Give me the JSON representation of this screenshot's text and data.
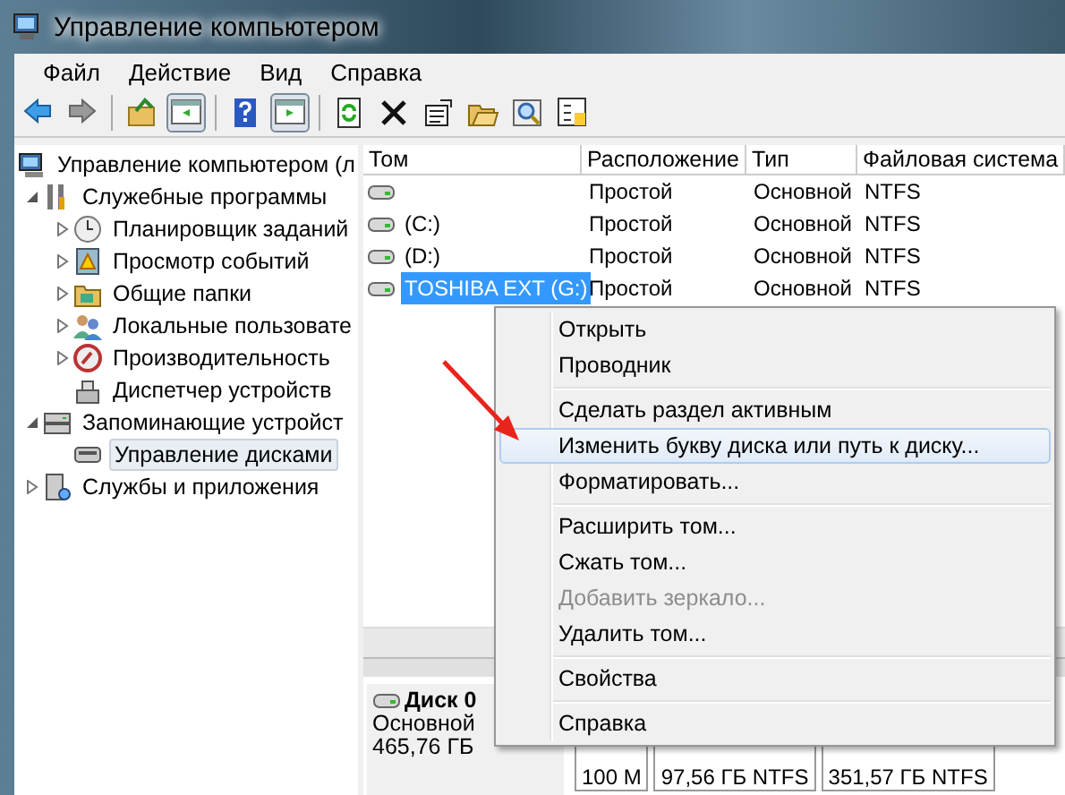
{
  "window": {
    "title": "Управление компьютером"
  },
  "menu_bar": [
    "Файл",
    "Действие",
    "Вид",
    "Справка"
  ],
  "toolbar": [
    {
      "kind": "back",
      "on": false
    },
    {
      "kind": "forward",
      "on": false
    },
    {
      "kind": "separator"
    },
    {
      "kind": "up",
      "on": false
    },
    {
      "kind": "tree",
      "on": true
    },
    {
      "kind": "separator"
    },
    {
      "kind": "help",
      "on": false
    },
    {
      "kind": "actions",
      "on": true
    },
    {
      "kind": "separator"
    },
    {
      "kind": "refresh",
      "on": false
    },
    {
      "kind": "delete",
      "on": false
    },
    {
      "kind": "properties",
      "on": false
    },
    {
      "kind": "open",
      "on": false
    },
    {
      "kind": "search",
      "on": false
    },
    {
      "kind": "more",
      "on": false
    }
  ],
  "tree": [
    {
      "label": "Управление компьютером (л",
      "selected": false,
      "children": [
        {
          "label": "Служебные программы",
          "expanded": true,
          "selected": false,
          "children": [
            {
              "label": "Планировщик заданий",
              "expanded": false,
              "selected": false
            },
            {
              "label": "Просмотр событий",
              "expanded": false,
              "selected": false
            },
            {
              "label": "Общие папки",
              "expanded": false,
              "selected": false
            },
            {
              "label": "Локальные пользовате",
              "expanded": false,
              "selected": false
            },
            {
              "label": "Производительность",
              "expanded": false,
              "selected": false
            },
            {
              "label": "Диспетчер устройств",
              "selected": false
            }
          ]
        },
        {
          "label": "Запоминающие устройст",
          "expanded": true,
          "selected": false,
          "children": [
            {
              "label": "Управление дисками",
              "selected": true
            }
          ]
        },
        {
          "label": "Службы и приложения",
          "expanded": false,
          "selected": false
        }
      ]
    }
  ],
  "volumes": {
    "columns": [
      "Том",
      "Расположение",
      "Тип",
      "Файловая система"
    ],
    "rows": [
      {
        "layout": "Простой",
        "type": "Основной",
        "fs": "NTFS",
        "selected": false
      },
      {
        "name": "(C:)",
        "layout": "Простой",
        "type": "Основной",
        "fs": "NTFS",
        "selected": false
      },
      {
        "name": "(D:)",
        "layout": "Простой",
        "type": "Основной",
        "fs": "NTFS",
        "selected": false
      },
      {
        "name": "TOSHIBA EXT (G:)",
        "layout": "Простой",
        "type": "Основной",
        "fs": "NTFS",
        "selected": true
      }
    ]
  },
  "disk": {
    "name": "Диск 0",
    "type": "Основной",
    "size": "465,76 ГБ",
    "partitions": [
      "100 М",
      "97,56 ГБ NTFS",
      "351,57 ГБ NTFS"
    ]
  },
  "context_menu": [
    {
      "kind": "item",
      "label": "Открыть",
      "disabled": false,
      "selected": false
    },
    {
      "kind": "item",
      "label": "Проводник",
      "disabled": false,
      "selected": false
    },
    {
      "kind": "separator"
    },
    {
      "kind": "item",
      "label": "Сделать раздел активным",
      "disabled": false,
      "selected": false
    },
    {
      "kind": "item",
      "label": "Изменить букву диска или путь к диску...",
      "disabled": false,
      "selected": true
    },
    {
      "kind": "item",
      "label": "Форматировать...",
      "disabled": false,
      "selected": false
    },
    {
      "kind": "separator"
    },
    {
      "kind": "item",
      "label": "Расширить том...",
      "disabled": false,
      "selected": false
    },
    {
      "kind": "item",
      "label": "Сжать том...",
      "disabled": false,
      "selected": false
    },
    {
      "kind": "item",
      "label": "Добавить зеркало...",
      "disabled": true,
      "selected": false
    },
    {
      "kind": "item",
      "label": "Удалить том...",
      "disabled": false,
      "selected": false
    },
    {
      "kind": "separator"
    },
    {
      "kind": "item",
      "label": "Свойства",
      "disabled": false,
      "selected": false
    },
    {
      "kind": "separator"
    },
    {
      "kind": "item",
      "label": "Справка",
      "disabled": false,
      "selected": false
    }
  ]
}
